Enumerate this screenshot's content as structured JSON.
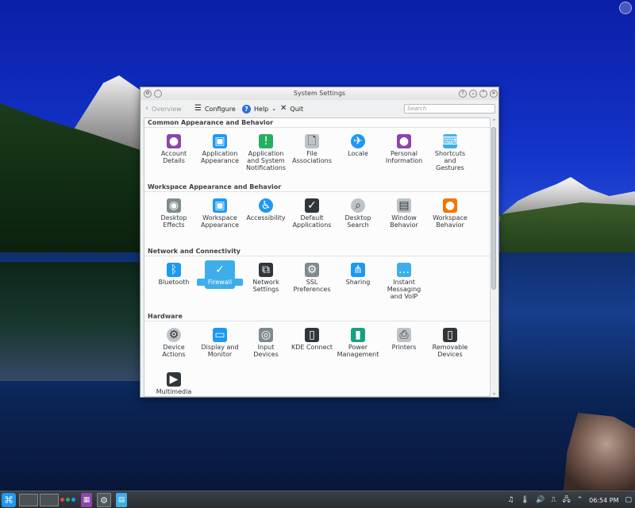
{
  "window": {
    "title": "System Settings",
    "toolbar": {
      "overview": "Overview",
      "configure": "Configure",
      "help": "Help",
      "quit": "Quit",
      "search_placeholder": "Search"
    }
  },
  "sections": [
    {
      "title": "Common Appearance and Behavior",
      "items": [
        {
          "label": "Account\nDetails",
          "icon": "account-icon"
        },
        {
          "label": "Application\nAppearance",
          "icon": "app-appearance-icon"
        },
        {
          "label": "Application\nand System\nNotifications",
          "icon": "notifications-icon"
        },
        {
          "label": "File\nAssociations",
          "icon": "file-associations-icon"
        },
        {
          "label": "Locale",
          "icon": "locale-icon"
        },
        {
          "label": "Personal\nInformation",
          "icon": "personal-info-icon"
        },
        {
          "label": "Shortcuts\nand\nGestures",
          "icon": "shortcuts-icon"
        }
      ]
    },
    {
      "title": "Workspace Appearance and Behavior",
      "items": [
        {
          "label": "Desktop\nEffects",
          "icon": "desktop-effects-icon"
        },
        {
          "label": "Workspace\nAppearance",
          "icon": "workspace-appearance-icon"
        },
        {
          "label": "Accessibility",
          "icon": "accessibility-icon"
        },
        {
          "label": "Default\nApplications",
          "icon": "default-apps-icon"
        },
        {
          "label": "Desktop\nSearch",
          "icon": "desktop-search-icon"
        },
        {
          "label": "Window\nBehavior",
          "icon": "window-behavior-icon"
        },
        {
          "label": "Workspace\nBehavior",
          "icon": "workspace-behavior-icon"
        }
      ]
    },
    {
      "title": "Network and Connectivity",
      "items": [
        {
          "label": "Bluetooth",
          "icon": "bluetooth-icon"
        },
        {
          "label": "Firewall",
          "icon": "firewall-icon",
          "selected": true
        },
        {
          "label": "Network\nSettings",
          "icon": "network-icon"
        },
        {
          "label": "SSL\nPreferences",
          "icon": "ssl-icon"
        },
        {
          "label": "Sharing",
          "icon": "sharing-icon"
        },
        {
          "label": "Instant\nMessaging\nand VoIP",
          "icon": "messaging-icon"
        }
      ]
    },
    {
      "title": "Hardware",
      "items": [
        {
          "label": "Device\nActions",
          "icon": "device-actions-icon"
        },
        {
          "label": "Display and\nMonitor",
          "icon": "display-icon"
        },
        {
          "label": "Input\nDevices",
          "icon": "input-devices-icon"
        },
        {
          "label": "KDE Connect",
          "icon": "kde-connect-icon"
        },
        {
          "label": "Power\nManagement",
          "icon": "power-icon"
        },
        {
          "label": "Printers",
          "icon": "printer-icon"
        },
        {
          "label": "Removable\nDevices",
          "icon": "removable-devices-icon"
        },
        {
          "label": "Multimedia",
          "icon": "multimedia-icon"
        }
      ]
    }
  ],
  "taskbar": {
    "clock": "06:54 PM"
  },
  "colors": {
    "accent": "#3daee9",
    "window_bg": "#eff0f1",
    "taskbar_bg": "#31363b"
  }
}
